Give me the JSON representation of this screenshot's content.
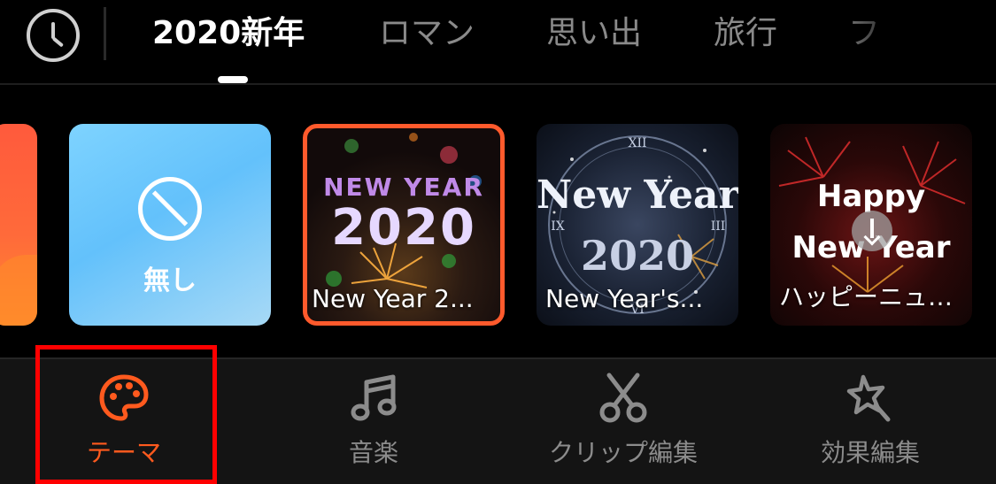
{
  "header": {
    "tabs": [
      {
        "label": "2020新年",
        "active": true
      },
      {
        "label": "ロマン",
        "active": false
      },
      {
        "label": "思い出",
        "active": false
      },
      {
        "label": "旅行",
        "active": false
      },
      {
        "label": "フ",
        "active": false
      }
    ]
  },
  "themes": {
    "none_label": "無し",
    "items": [
      {
        "label": "New Year 2...",
        "art_line1": "NEW YEAR",
        "art_line2": "2020",
        "selected": true
      },
      {
        "label": "New Year's...",
        "art_line1": "New Year",
        "art_line2": "2020",
        "selected": false
      },
      {
        "label": "ハッピーニュ…",
        "art_line1": "Happy",
        "art_line2": "New Year",
        "selected": false,
        "downloadable": true
      }
    ]
  },
  "bottom_nav": {
    "items": [
      {
        "label": "テーマ",
        "icon": "palette-icon",
        "active": true
      },
      {
        "label": "音楽",
        "icon": "music-note-icon",
        "active": false
      },
      {
        "label": "クリップ編集",
        "icon": "scissors-icon",
        "active": false
      },
      {
        "label": "効果編集",
        "icon": "magic-star-icon",
        "active": false
      }
    ]
  },
  "colors": {
    "accent": "#ff5a1e",
    "selected_border": "#ff5a2c",
    "highlight_box": "#ff0000",
    "inactive_text": "#8c8c8c"
  }
}
